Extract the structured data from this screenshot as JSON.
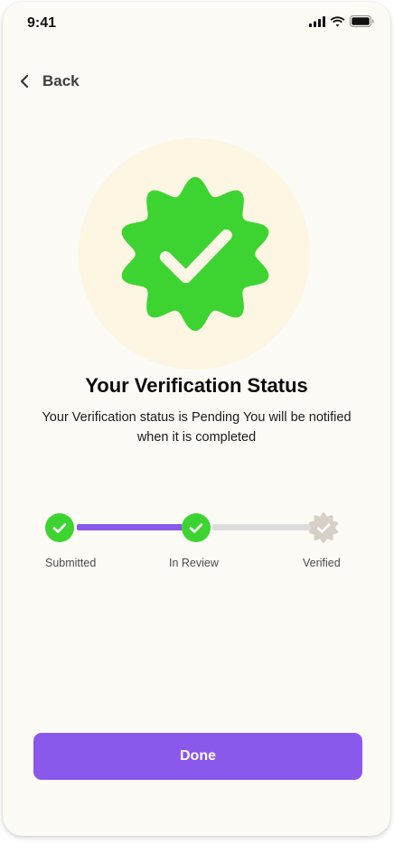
{
  "status_bar": {
    "time": "9:41",
    "icons": [
      "cellular-signal-icon",
      "wifi-icon",
      "battery-icon"
    ]
  },
  "header": {
    "back_label": "Back",
    "back_icon": "chevron-left-icon"
  },
  "hero": {
    "icon": "verified-badge-icon",
    "badge_color": "#3dd432",
    "circle_color": "#fcf6e3"
  },
  "content": {
    "title": "Your Verification Status",
    "subtitle": "Your Verification status is Pending You will be notified when it is completed"
  },
  "stepper": {
    "steps": [
      {
        "label": "Submitted",
        "state": "complete"
      },
      {
        "label": "In Review",
        "state": "complete"
      },
      {
        "label": "Verified",
        "state": "pending"
      }
    ],
    "colors": {
      "complete": "#3dd432",
      "pending": "#d6d0c6",
      "line_active": "#8a58ea",
      "line_inactive": "#dcdcdc"
    }
  },
  "actions": {
    "done_label": "Done",
    "accent": "#8a58ea"
  }
}
